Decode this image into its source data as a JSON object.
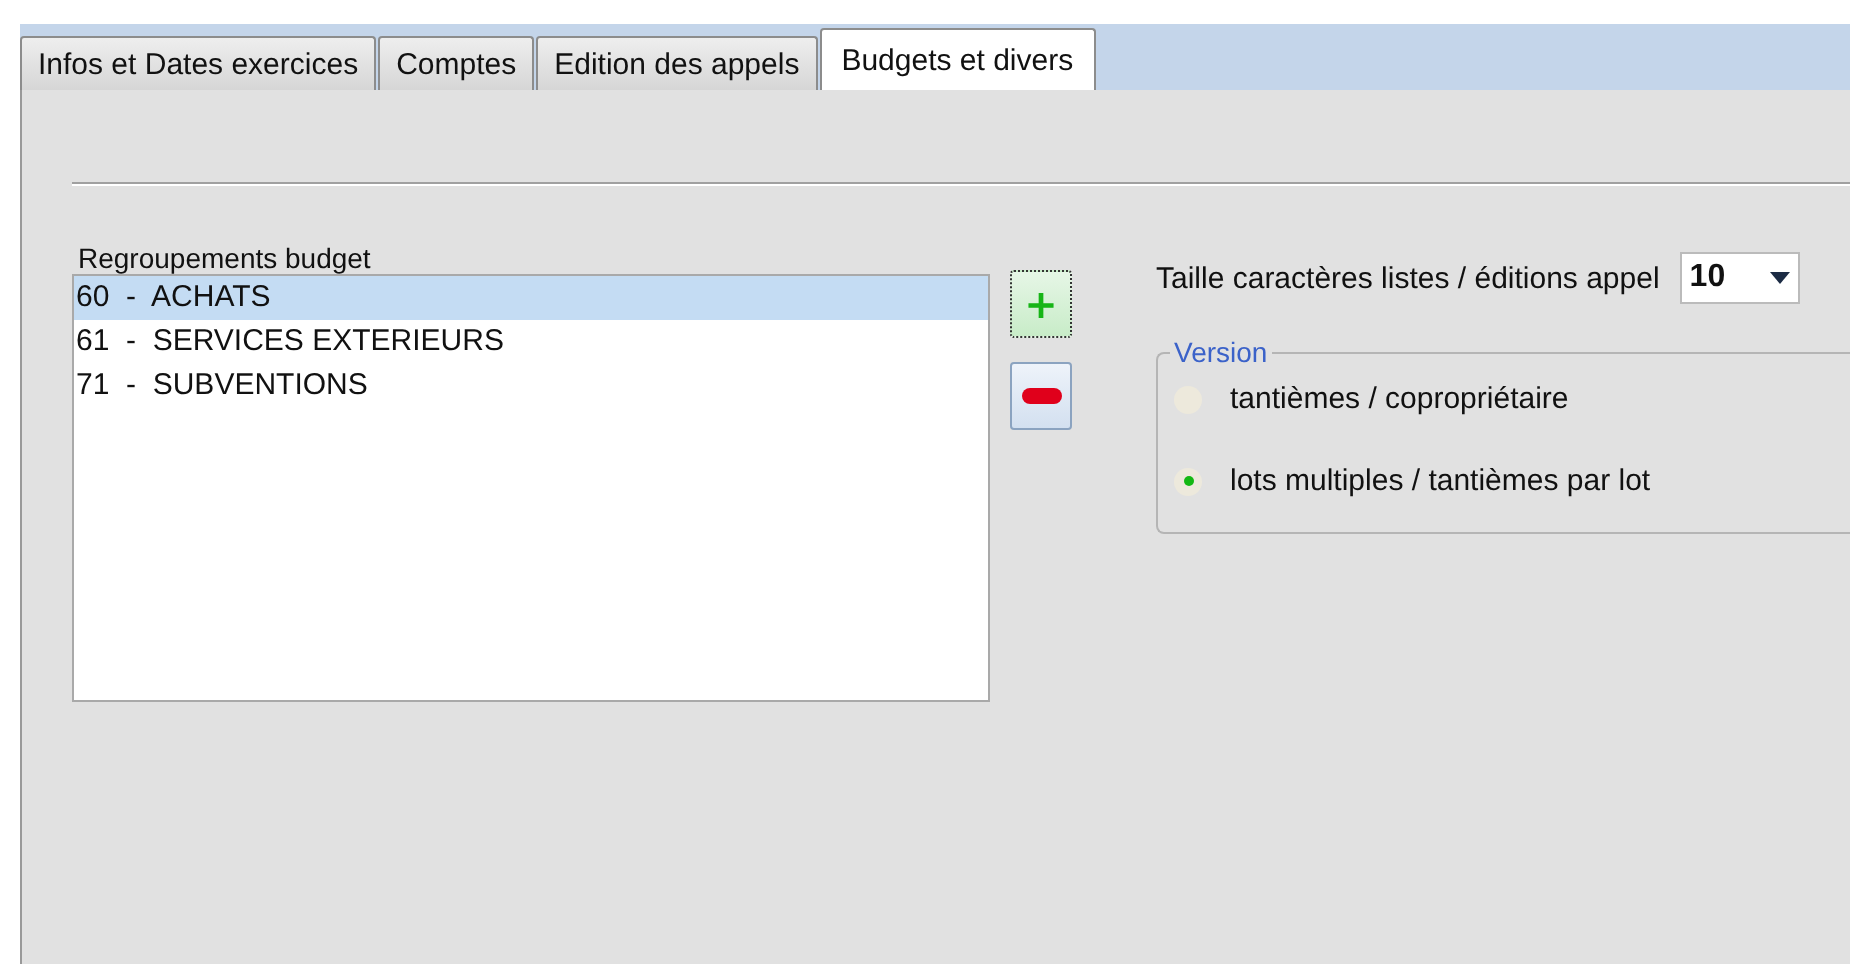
{
  "tabs": [
    {
      "label": "Infos et Dates exercices",
      "selected": false
    },
    {
      "label": "Comptes",
      "selected": false
    },
    {
      "label": "Edition des appels",
      "selected": false
    },
    {
      "label": "Budgets et divers",
      "selected": true
    }
  ],
  "budget_groups": {
    "label": "Regroupements budget",
    "items": [
      {
        "text": "60  -  ACHATS",
        "selected": true
      },
      {
        "text": "61  -  SERVICES EXTERIEURS",
        "selected": false
      },
      {
        "text": "71  -  SUBVENTIONS",
        "selected": false
      }
    ]
  },
  "add_button": {
    "symbol": "+"
  },
  "font_size": {
    "label": "Taille caractères listes / éditions appel",
    "value": "10"
  },
  "version": {
    "legend": "Version",
    "options": [
      {
        "label": "tantièmes / copropriétaire",
        "selected": false
      },
      {
        "label": "lots multiples / tantièmes par lot",
        "selected": true
      }
    ]
  }
}
